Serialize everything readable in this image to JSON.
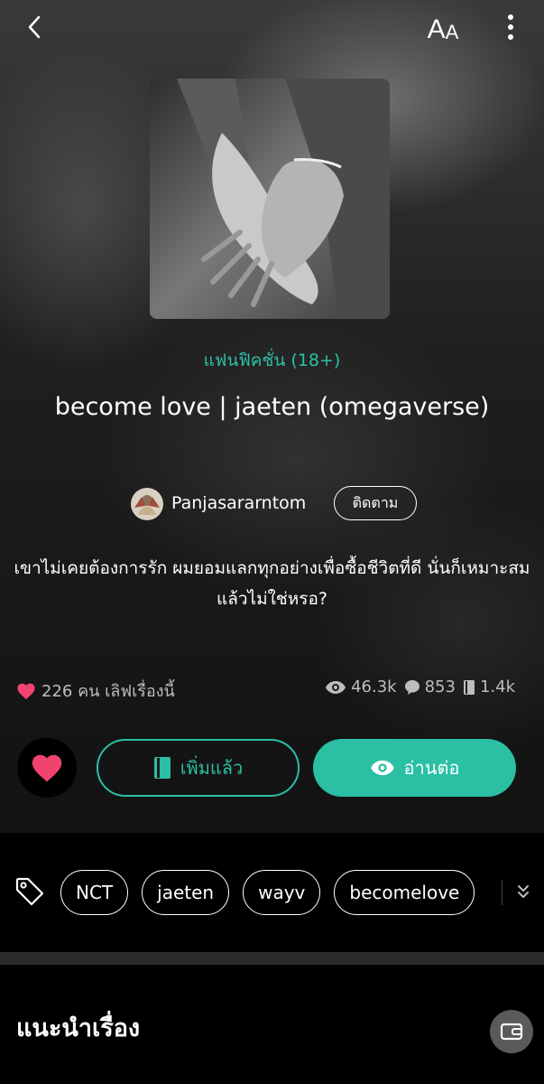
{
  "topbar": {
    "back_icon": "chevron-left-icon",
    "font_size_label_big": "A",
    "font_size_label_small": "A",
    "more_icon": "more-vertical-icon"
  },
  "story": {
    "genre": "แฟนฟิคชั่น  (18+)",
    "title": "become love | jaeten (omegaverse)",
    "author": "Panjasararntom",
    "follow_label": "ติดตาม",
    "synopsis": "เขาไม่เคยต้องการรัก ผมยอมแลกทุกอย่างเพื่อซื้อชีวิตที่ดี นั่นก็เหมาะสมแล้วไม่ใช่หรอ?"
  },
  "stats": {
    "love_text": "226 คน เลิฟเรื่องนี้",
    "views": "46.3k",
    "comments": "853",
    "saves": "1.4k"
  },
  "actions": {
    "added_label": "เพิ่มแล้ว",
    "read_label": "อ่านต่อ"
  },
  "tags": [
    "NCT",
    "jaeten",
    "wayv",
    "becomelove"
  ],
  "recommend": {
    "title": "แนะนำเรื่อง"
  },
  "colors": {
    "accent": "#2bbfa4",
    "heart": "#f0446e"
  }
}
